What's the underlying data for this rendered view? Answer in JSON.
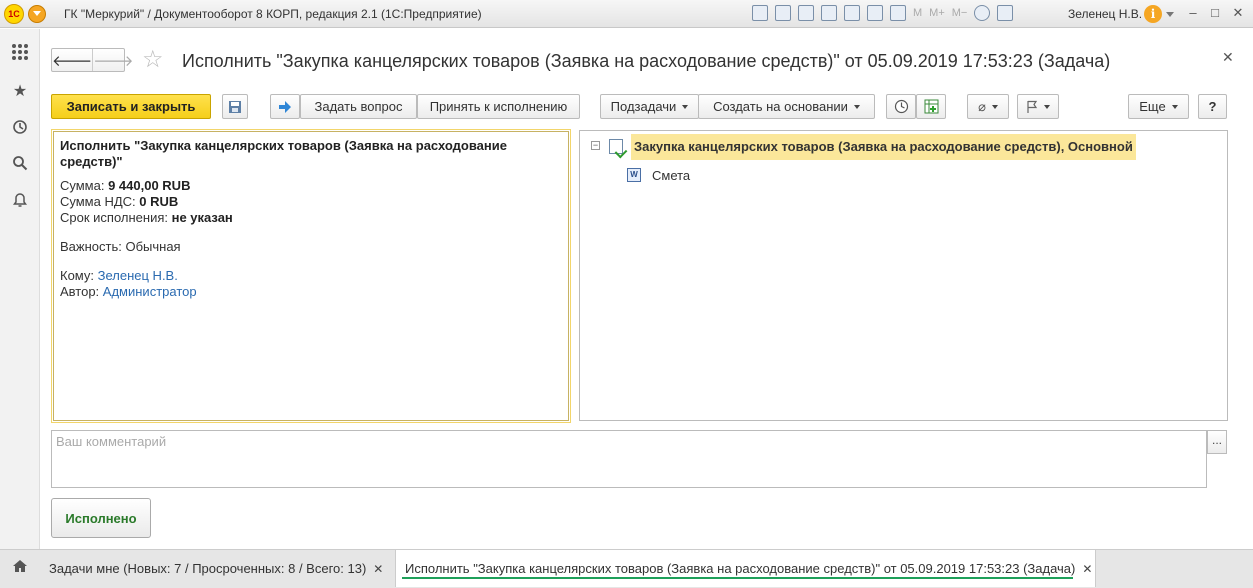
{
  "window": {
    "title": "ГК \"Меркурий\" / Документооборот 8 КОРП, редакция 2.1  (1С:Предприятие)",
    "logo_text": "1С",
    "toolbar_letters": [
      "M",
      "M+",
      "M−"
    ],
    "user": "Зеленец Н.В.",
    "info_label": "i"
  },
  "form": {
    "title": "Исполнить \"Закупка канцелярских товаров (Заявка на расходование средств)\" от 05.09.2019 17:53:23 (Задача)",
    "toolbar": {
      "save_close": "Записать и закрыть",
      "ask_question": "Задать вопрос",
      "accept": "Принять к исполнению",
      "subtasks": "Подзадачи",
      "create_based": "Создать на основании",
      "more": "Еще",
      "help": "?"
    },
    "info": {
      "title": "Исполнить \"Закупка канцелярских товаров (Заявка на расходование средств)\"",
      "sum_label": "Сумма: ",
      "sum_value": "9 440,00 RUB",
      "vat_label": "Сумма НДС: ",
      "vat_value": "0 RUB",
      "deadline_label": "Срок исполнения: ",
      "deadline_value": "не указан",
      "importance_label": "Важность: ",
      "importance_value": "Обычная",
      "to_label": "Кому: ",
      "to_value": "Зеленец Н.В.",
      "author_label": "Автор: ",
      "author_value": "Администратор"
    },
    "tree": {
      "root": "Закупка канцелярских товаров (Заявка на расходование средств), Основной",
      "child": "Смета",
      "child_icon_label": "W"
    },
    "comment_placeholder": "Ваш комментарий",
    "comment_more": "...",
    "done_button": "Исполнено"
  },
  "tabs": [
    {
      "label": "Задачи мне (Новых: 7 / Просроченных: 8 / Всего: 13)"
    },
    {
      "label": "Исполнить \"Закупка канцелярских товаров (Заявка на расходование средств)\" от 05.09.2019 17:53:23 (Задача)"
    }
  ],
  "colors": {
    "accent_yellow": "#f5cf1a",
    "tree_highlight": "#fbe79a",
    "link": "#2a6ab0",
    "done_text": "#2a7a2a",
    "active_tab_underline": "#1ea05a"
  }
}
